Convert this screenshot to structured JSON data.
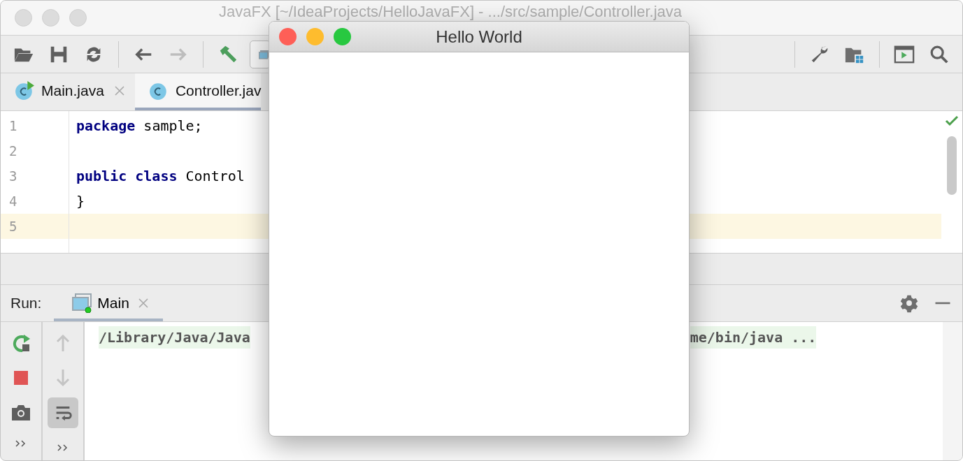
{
  "ide_window": {
    "title": "JavaFX [~/IdeaProjects/HelloJavaFX] - .../src/sample/Controller.java"
  },
  "navigation": {
    "back_disabled": false,
    "forward_disabled": true
  },
  "editor_tabs": [
    {
      "label": "Main.java",
      "selected": false,
      "kind": "runnable",
      "closable": true
    },
    {
      "label": "Controller.jav",
      "selected": true,
      "kind": "class",
      "closable": false
    }
  ],
  "editor": {
    "lines": [
      {
        "number": "1",
        "current": false,
        "segments": [
          {
            "text": "package",
            "kind": "keyword"
          },
          {
            "text": " sample;",
            "kind": "plain"
          }
        ]
      },
      {
        "number": "2",
        "current": false
      },
      {
        "number": "3",
        "current": false,
        "segments": [
          {
            "text": "public class",
            "kind": "keyword"
          },
          {
            "text": " Control",
            "kind": "plain"
          }
        ]
      },
      {
        "number": "4",
        "current": false,
        "segments": [
          {
            "text": "}",
            "kind": "plain"
          }
        ]
      },
      {
        "number": "5",
        "current": true
      }
    ],
    "inspection_ok": true
  },
  "run_panel": {
    "label": "Run:",
    "tabs": [
      {
        "label": "Main",
        "selected": true,
        "closable": true
      }
    ],
    "soft_wrap": {
      "on": true
    },
    "output": [
      {
        "text": "/Library/Java/Java"
      },
      {
        "text": "me/bin/java ..."
      }
    ]
  },
  "popup_window": {
    "title": "Hello World"
  }
}
